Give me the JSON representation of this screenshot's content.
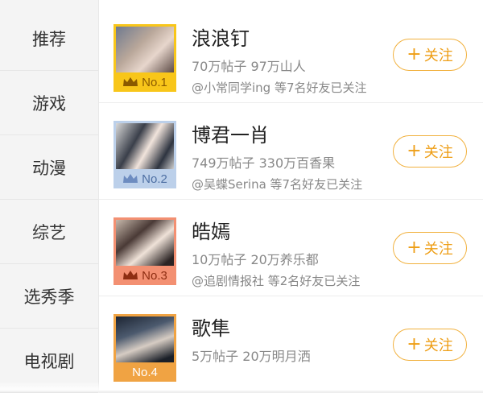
{
  "sidebar": {
    "items": [
      {
        "label": "推荐"
      },
      {
        "label": "游戏"
      },
      {
        "label": "动漫"
      },
      {
        "label": "综艺"
      },
      {
        "label": "选秀季"
      },
      {
        "label": "电视剧"
      }
    ]
  },
  "list": {
    "items": [
      {
        "title": "浪浪钉",
        "stats": "70万帖子 97万山人",
        "friends": "@小常同学ing 等7名好友已关注",
        "rank": "No.1",
        "follow_label": "关注",
        "frame_color": "#f8c61a",
        "rank_color": "#8a5a00"
      },
      {
        "title": "博君一肖",
        "stats": "749万帖子 330万百香果",
        "friends": "@吴蝶Serina 等7名好友已关注",
        "rank": "No.2",
        "follow_label": "关注",
        "frame_color": "#bcd0ea",
        "rank_color": "#4d6fa3"
      },
      {
        "title": "皓嫣",
        "stats": "10万帖子 20万养乐都",
        "friends": "@追剧情报社 等2名好友已关注",
        "rank": "No.3",
        "follow_label": "关注",
        "frame_color": "#f39072",
        "rank_color": "#8e2e12"
      },
      {
        "title": "歌隼",
        "stats": "5万帖子 20万明月洒",
        "friends": "",
        "rank": "No.4",
        "follow_label": "关注",
        "frame_color": "#f0a343",
        "rank_color": "#ffffff"
      }
    ]
  },
  "colors": {
    "accent": "#ee9e16",
    "follow_border": "#f1b13e"
  }
}
